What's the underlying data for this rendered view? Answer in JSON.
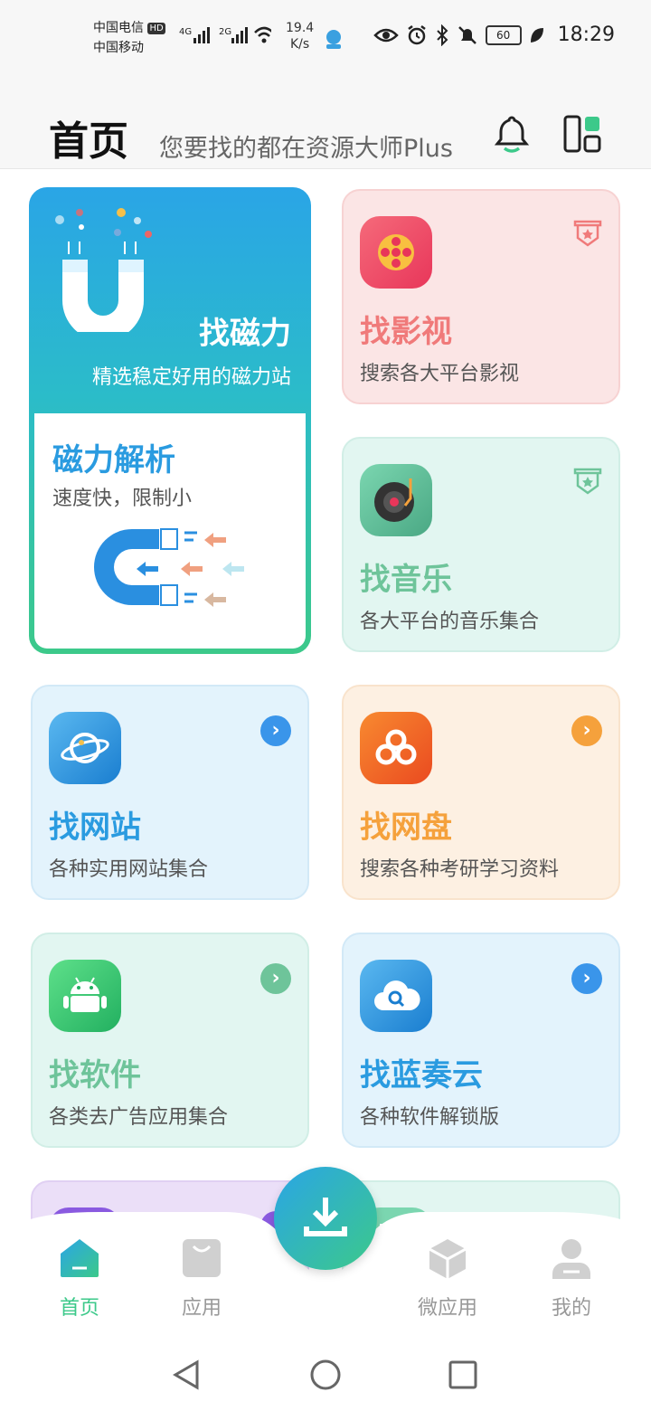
{
  "status_bar": {
    "carrier1": "中国电信",
    "carrier2": "中国移动",
    "hd": "HD",
    "net1": "4G",
    "net2": "2G",
    "speed_value": "19.4",
    "speed_unit": "K/s",
    "battery": "60",
    "time": "18:29"
  },
  "header": {
    "title": "首页",
    "subtitle": "您要找的都在资源大师Plus",
    "bell_icon": "bell-icon",
    "layout_icon": "layout-grid-icon"
  },
  "cards": {
    "magnet": {
      "title": "找磁力",
      "desc": "精选稳定好用的磁力站"
    },
    "magnet_parse": {
      "title": "磁力解析",
      "desc": "速度快，限制小"
    },
    "video": {
      "title": "找影视",
      "desc": "搜索各大平台影视",
      "color": "#f07a7a"
    },
    "music": {
      "title": "找音乐",
      "desc": "各大平台的音乐集合",
      "color": "#6ec49a"
    },
    "website": {
      "title": "找网站",
      "desc": "各种实用网站集合",
      "color": "#2a9be0"
    },
    "netdisk": {
      "title": "找网盘",
      "desc": "搜索各种考研学习资料",
      "color": "#f5a13c"
    },
    "software": {
      "title": "找软件",
      "desc": "各类去广告应用集合",
      "color": "#6ec49a"
    },
    "lanzou": {
      "title": "找蓝奏云",
      "desc": "各种软件解锁版",
      "color": "#2a9be0"
    }
  },
  "nav": {
    "home": "首页",
    "apps": "应用",
    "micro": "微应用",
    "mine": "我的"
  }
}
